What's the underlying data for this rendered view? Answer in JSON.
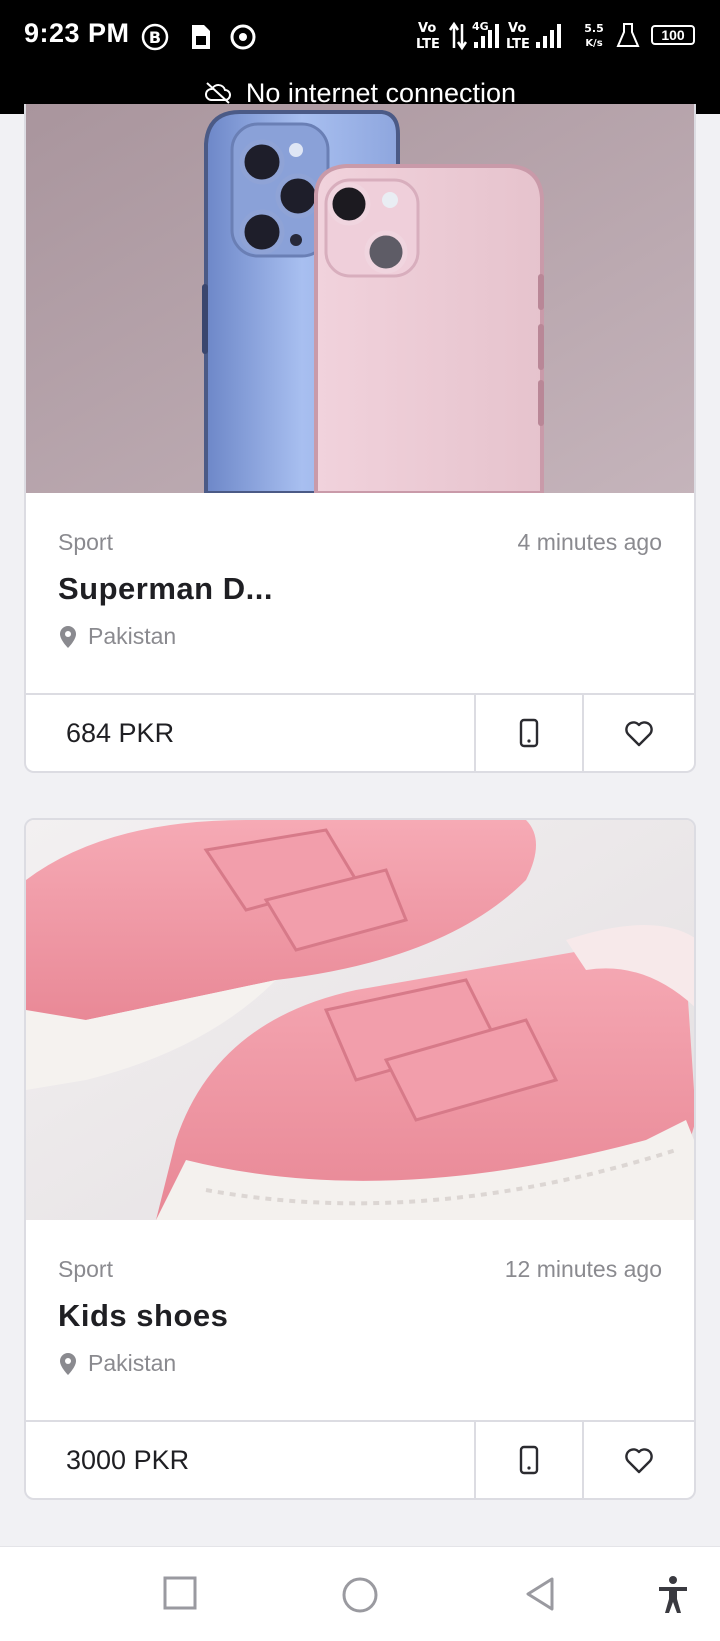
{
  "status_bar": {
    "time": "9:23 PM",
    "network_text": "Vo LTE 4G Vo LTE",
    "speed": "5.5 K/s",
    "battery": "100"
  },
  "offline_banner": {
    "text": "No internet connection",
    "icon": "cloud-off-icon"
  },
  "listings": [
    {
      "category": "Sport",
      "time_ago": "4 minutes ago",
      "title": "Superman D...",
      "location": "Pakistan",
      "price": "684 PKR"
    },
    {
      "category": "Sport",
      "time_ago": "12 minutes ago",
      "title": "Kids shoes",
      "location": "Pakistan",
      "price": "3000 PKR"
    }
  ],
  "nav_bar": {
    "icons": [
      "recents-icon",
      "home-icon",
      "back-icon",
      "accessibility-icon"
    ]
  },
  "colors": {
    "accent_text": "#1f1f23",
    "muted_text": "#8a8a8f",
    "border": "#dcdce2",
    "background": "#f1f1f4"
  }
}
